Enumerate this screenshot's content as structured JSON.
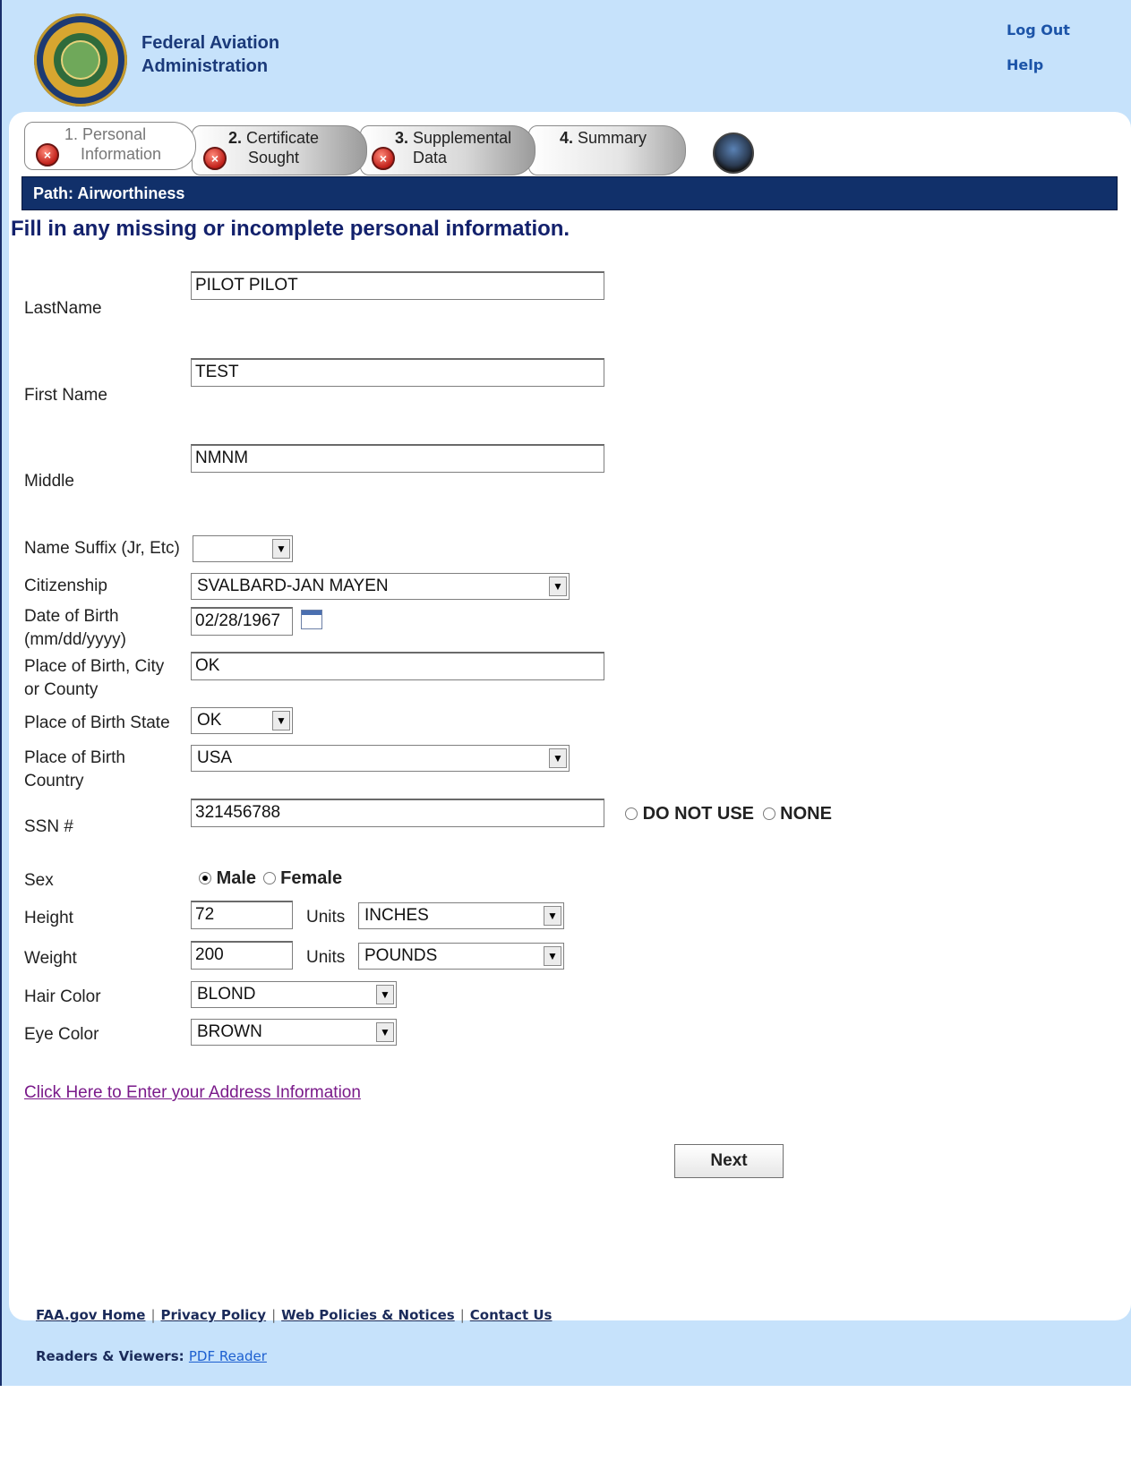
{
  "header": {
    "agency_line1": "Federal Aviation",
    "agency_line2": "Administration",
    "logout": "Log Out",
    "help": "Help",
    "logo_icon": "faa-seal-icon"
  },
  "tabs": [
    {
      "num": "1.",
      "line1": "Personal",
      "line2": "Information"
    },
    {
      "num": "2.",
      "line1": "Certificate",
      "line2": "Sought"
    },
    {
      "num": "3.",
      "line1": "Supplemental",
      "line2": "Data"
    },
    {
      "num": "4.",
      "line1": "Summary",
      "line2": ""
    }
  ],
  "path": "Path: Airworthiness",
  "heading": "Fill in any missing or incomplete personal information.",
  "form": {
    "last_name": {
      "label": "LastName",
      "value": "PILOT PILOT"
    },
    "first_name": {
      "label": "First Name",
      "value": "TEST"
    },
    "middle": {
      "label": "Middle",
      "value": "NMNM"
    },
    "suffix": {
      "label": "Name Suffix (Jr, Etc)",
      "value": ""
    },
    "citizenship": {
      "label": "Citizenship",
      "value": "SVALBARD-JAN MAYEN"
    },
    "dob": {
      "label1": "Date of Birth",
      "label2": "(mm/dd/yyyy)",
      "value": "02/28/1967"
    },
    "birth_city": {
      "label1": "Place of Birth, City",
      "label2": "or County",
      "value": "OK"
    },
    "birth_state": {
      "label": "Place of Birth State",
      "value": "OK"
    },
    "birth_country": {
      "label1": "Place of Birth",
      "label2": "Country",
      "value": "USA"
    },
    "ssn": {
      "label": "SSN #",
      "value": "321456788",
      "opt1": "DO NOT USE",
      "opt2": "NONE"
    },
    "sex": {
      "label": "Sex",
      "opt1": "Male",
      "opt2": "Female",
      "selected": "Male"
    },
    "height": {
      "label": "Height",
      "value": "72",
      "units_label": "Units",
      "units": "INCHES"
    },
    "weight": {
      "label": "Weight",
      "value": "200",
      "units_label": "Units",
      "units": "POUNDS"
    },
    "hair": {
      "label": "Hair Color",
      "value": "BLOND"
    },
    "eye": {
      "label": "Eye Color",
      "value": "BROWN"
    }
  },
  "address_link": "Click Here to Enter your Address Information",
  "next": "Next",
  "footer": {
    "links": [
      "FAA.gov Home",
      "Privacy Policy",
      "Web Policies & Notices",
      "Contact Us"
    ],
    "readers_label": "Readers & Viewers:",
    "pdf": "PDF Reader"
  }
}
